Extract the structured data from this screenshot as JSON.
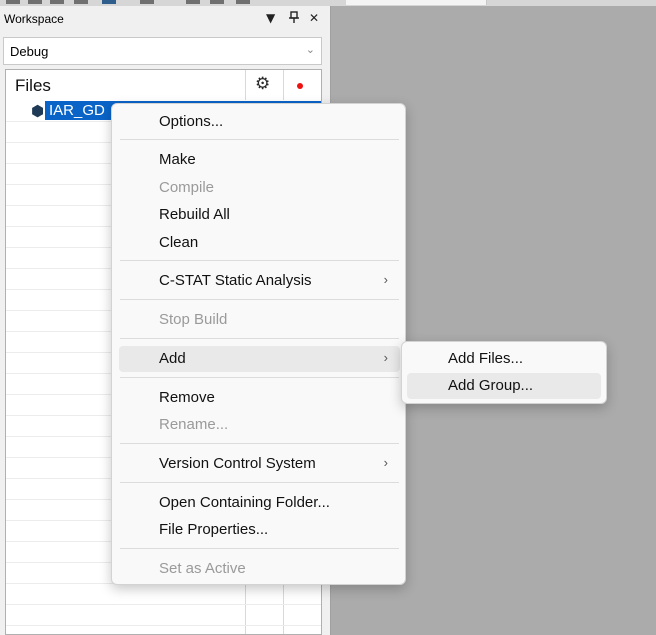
{
  "panel": {
    "title": "Workspace",
    "controls": {
      "dropdown": "▼",
      "pin": "ᵖ",
      "close": "✕"
    },
    "configuration": "Debug",
    "files_header": "Files",
    "project_name": "IAR_GD"
  },
  "context_menu": {
    "options": "Options...",
    "make": "Make",
    "compile": "Compile",
    "rebuild_all": "Rebuild All",
    "clean": "Clean",
    "cstat": "C-STAT Static Analysis",
    "stop_build": "Stop Build",
    "add": "Add",
    "remove": "Remove",
    "rename": "Rename...",
    "version_control": "Version Control System",
    "open_folder": "Open Containing Folder...",
    "file_properties": "File Properties...",
    "set_as_active": "Set as Active",
    "submenu_arrow": "›"
  },
  "add_submenu": {
    "add_files": "Add Files...",
    "add_group": "Add Group..."
  },
  "colors": {
    "selection": "#0a64c8",
    "menu_bg": "#f9f9f9",
    "disabled_text": "#9a9a9a",
    "background": "#ababab"
  }
}
